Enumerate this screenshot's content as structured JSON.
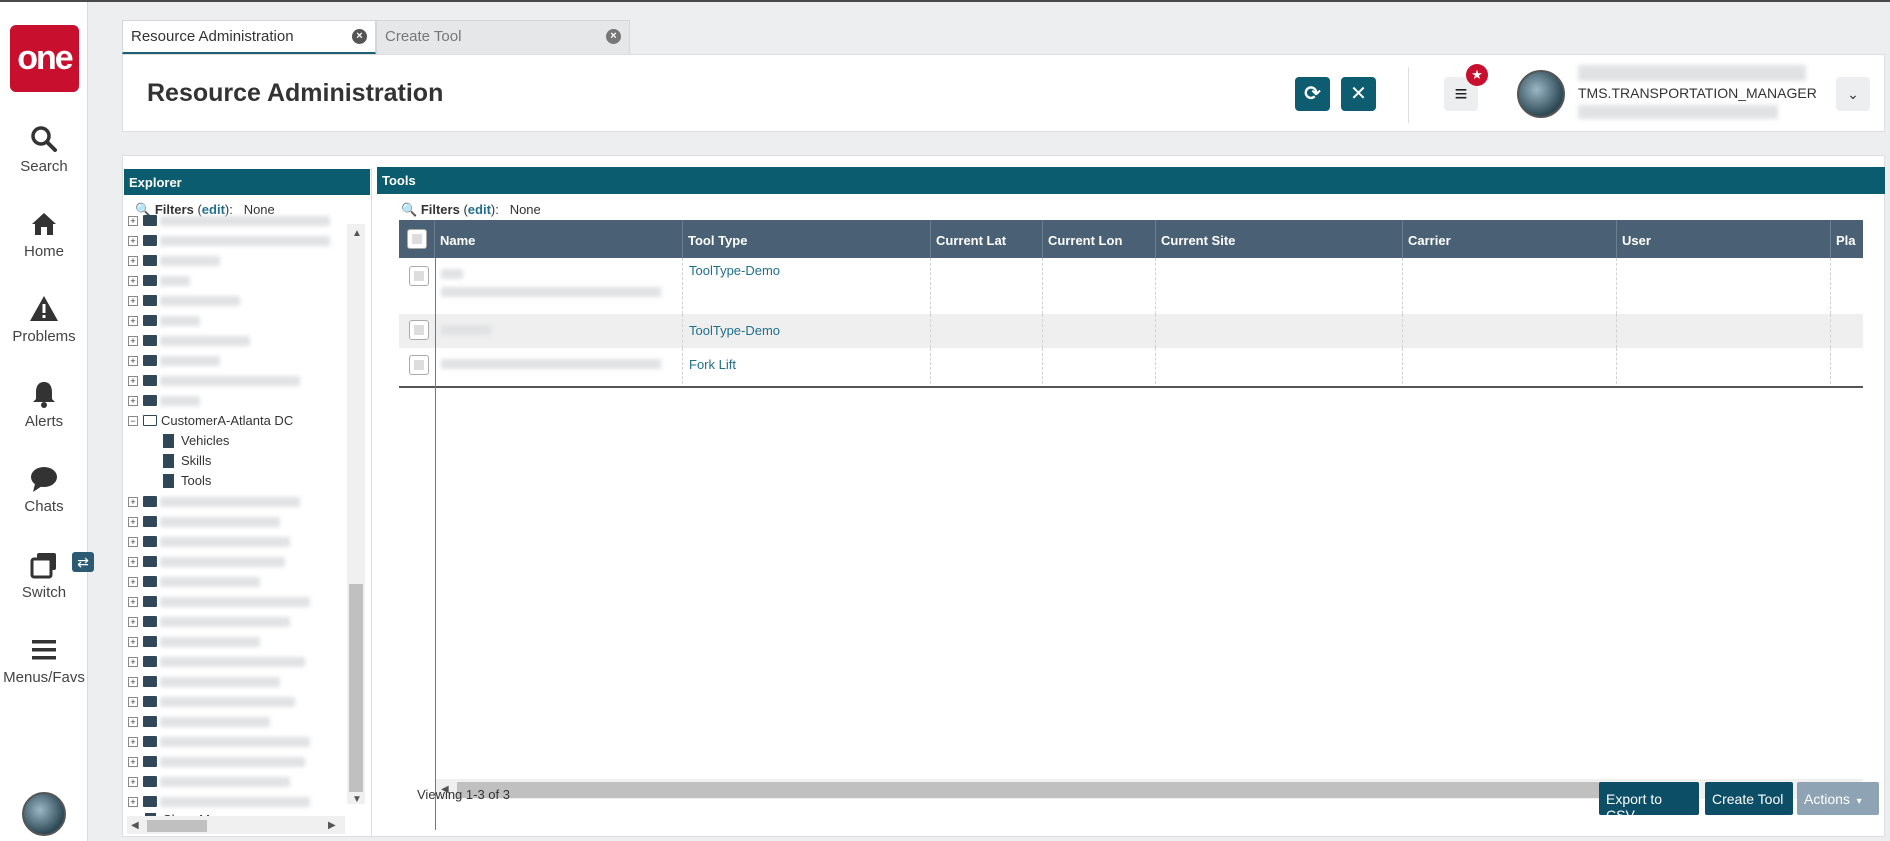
{
  "nav": {
    "logo": "one",
    "items": [
      {
        "label": "Search",
        "icon": "search-icon"
      },
      {
        "label": "Home",
        "icon": "home-icon"
      },
      {
        "label": "Problems",
        "icon": "warning-icon"
      },
      {
        "label": "Alerts",
        "icon": "bell-icon"
      },
      {
        "label": "Chats",
        "icon": "chat-icon"
      },
      {
        "label": "Switch",
        "icon": "switch-icon"
      },
      {
        "label": "Menus/Favs",
        "icon": "hamburger-icon"
      }
    ],
    "switch_badge": "⇄"
  },
  "tabs": [
    {
      "label": "Resource Administration",
      "active": true
    },
    {
      "label": "Create Tool",
      "active": false
    }
  ],
  "header": {
    "title": "Resource Administration",
    "refresh_icon": "refresh-icon",
    "close_icon": "close-icon",
    "menu_glyph": "≡",
    "close_glyph": "✕",
    "refresh_glyph": "⟳",
    "star_glyph": "★",
    "username": "TMS.TRANSPORTATION_MANAGER",
    "dropdown_glyph": "⌄"
  },
  "explorer": {
    "title": "Explorer",
    "filters_label": "Filters",
    "filters_edit": "edit",
    "filters_value": "None",
    "expanded_node": "CustomerA-Atlanta DC",
    "children": [
      "Vehicles",
      "Skills",
      "Tools"
    ],
    "show_more": "Show More..."
  },
  "tools": {
    "title": "Tools",
    "filters_label": "Filters",
    "filters_edit": "edit",
    "filters_value": "None",
    "columns": [
      "Name",
      "Tool Type",
      "Current Lat",
      "Current Lon",
      "Current Site",
      "Carrier",
      "User",
      "Pla"
    ],
    "rows": [
      {
        "tool_type": "ToolType-Demo"
      },
      {
        "tool_type": "ToolType-Demo"
      },
      {
        "tool_type": "Fork Lift"
      }
    ],
    "viewing": "Viewing 1-3 of 3"
  },
  "footer": {
    "export_csv": "Export to CSV",
    "create_tool": "Create Tool",
    "actions": "Actions"
  },
  "colors": {
    "brand_red": "#c8102e",
    "panel_header": "#0b5c6f",
    "grid_header": "#4a6074",
    "primary_button": "#0b4e66",
    "link": "#1f6f8b"
  }
}
